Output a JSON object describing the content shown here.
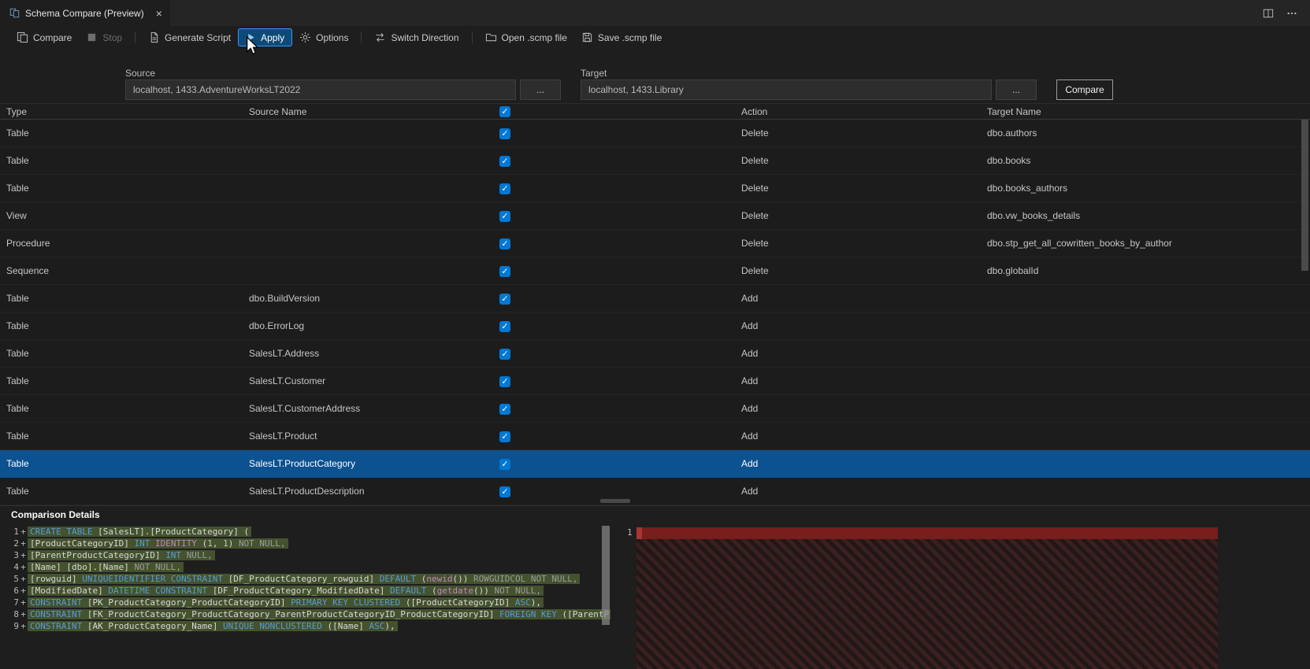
{
  "colors": {
    "accent_blue": "#3794ff",
    "checkbox_blue": "#0078d4",
    "selected_row_blue": "#0c5190",
    "diff_added_green_bg": "#44522e",
    "diff_removed_red": "#7a1d1d"
  },
  "tab": {
    "title": "Schema Compare (Preview)",
    "close_glyph": "×",
    "icon": "schema-compare-icon"
  },
  "window_actions": {
    "icons": [
      "split-editor-icon",
      "more-actions-icon"
    ]
  },
  "toolbar": {
    "items": [
      {
        "label": "Compare",
        "icon": "compare-icon"
      },
      {
        "label": "Stop",
        "icon": "stop-icon",
        "disabled": true
      },
      {
        "label": "Generate Script",
        "icon": "generate-script-icon"
      },
      {
        "label": "Apply",
        "icon": "play-icon",
        "active": true
      },
      {
        "label": "Options",
        "icon": "gear-icon"
      },
      {
        "label": "Switch Direction",
        "icon": "switch-direction-icon"
      },
      {
        "label": "Open .scmp file",
        "icon": "open-file-icon"
      },
      {
        "label": "Save .scmp file",
        "icon": "save-icon"
      }
    ]
  },
  "connections": {
    "source": {
      "label": "Source",
      "value": "localhost, 1433.AdventureWorksLT2022",
      "browse": "..."
    },
    "target": {
      "label": "Target",
      "value": "localhost, 1433.Library",
      "browse": "..."
    },
    "compare_button": "Compare"
  },
  "grid": {
    "check_glyph": "✓",
    "columns": {
      "type": "Type",
      "source": "Source Name",
      "action": "Action",
      "target": "Target Name"
    },
    "rows": [
      {
        "type": "Table",
        "source": "",
        "checked": true,
        "action": "Delete",
        "target": "dbo.authors",
        "selected": false
      },
      {
        "type": "Table",
        "source": "",
        "checked": true,
        "action": "Delete",
        "target": "dbo.books",
        "selected": false
      },
      {
        "type": "Table",
        "source": "",
        "checked": true,
        "action": "Delete",
        "target": "dbo.books_authors",
        "selected": false
      },
      {
        "type": "View",
        "source": "",
        "checked": true,
        "action": "Delete",
        "target": "dbo.vw_books_details",
        "selected": false
      },
      {
        "type": "Procedure",
        "source": "",
        "checked": true,
        "action": "Delete",
        "target": "dbo.stp_get_all_cowritten_books_by_author",
        "selected": false
      },
      {
        "type": "Sequence",
        "source": "",
        "checked": true,
        "action": "Delete",
        "target": "dbo.globalId",
        "selected": false
      },
      {
        "type": "Table",
        "source": "dbo.BuildVersion",
        "checked": true,
        "action": "Add",
        "target": "",
        "selected": false
      },
      {
        "type": "Table",
        "source": "dbo.ErrorLog",
        "checked": true,
        "action": "Add",
        "target": "",
        "selected": false
      },
      {
        "type": "Table",
        "source": "SalesLT.Address",
        "checked": true,
        "action": "Add",
        "target": "",
        "selected": false
      },
      {
        "type": "Table",
        "source": "SalesLT.Customer",
        "checked": true,
        "action": "Add",
        "target": "",
        "selected": false
      },
      {
        "type": "Table",
        "source": "SalesLT.CustomerAddress",
        "checked": true,
        "action": "Add",
        "target": "",
        "selected": false
      },
      {
        "type": "Table",
        "source": "SalesLT.Product",
        "checked": true,
        "action": "Add",
        "target": "",
        "selected": false
      },
      {
        "type": "Table",
        "source": "SalesLT.ProductCategory",
        "checked": true,
        "action": "Add",
        "target": "",
        "selected": true
      },
      {
        "type": "Table",
        "source": "SalesLT.ProductDescription",
        "checked": true,
        "action": "Add",
        "target": "",
        "selected": false
      }
    ]
  },
  "details": {
    "title": "Comparison Details",
    "left_editor": {
      "lines": [
        {
          "num": "1",
          "sign": "+",
          "tokens": [
            [
              "k",
              "CREATE TABLE "
            ],
            [
              "d",
              "[SalesLT].[ProductCategory] ("
            ]
          ]
        },
        {
          "num": "2",
          "sign": "+",
          "tokens": [
            [
              "d",
              "[ProductCategoryID] "
            ],
            [
              "k",
              "INT "
            ],
            [
              "f",
              "IDENTITY "
            ],
            [
              "d",
              "("
            ],
            [
              "n",
              "1"
            ],
            [
              "d",
              ", "
            ],
            [
              "n",
              "1"
            ],
            [
              "d",
              ") "
            ],
            [
              "g",
              "NOT NULL,"
            ]
          ]
        },
        {
          "num": "3",
          "sign": "+",
          "tokens": [
            [
              "d",
              "[ParentProductCategoryID] "
            ],
            [
              "k",
              "INT "
            ],
            [
              "g",
              "NULL,"
            ]
          ]
        },
        {
          "num": "4",
          "sign": "+",
          "tokens": [
            [
              "d",
              "[Name] [dbo].[Name] "
            ],
            [
              "g",
              "NOT NULL,"
            ]
          ]
        },
        {
          "num": "5",
          "sign": "+",
          "tokens": [
            [
              "d",
              "[rowguid] "
            ],
            [
              "k",
              "UNIQUEIDENTIFIER "
            ],
            [
              "k",
              "CONSTRAINT "
            ],
            [
              "d",
              "[DF_ProductCategory_rowguid] "
            ],
            [
              "k",
              "DEFAULT "
            ],
            [
              "d",
              "("
            ],
            [
              "f",
              "newid"
            ],
            [
              "d",
              "()) "
            ],
            [
              "g",
              "ROWGUIDCOL NOT NULL,"
            ]
          ]
        },
        {
          "num": "6",
          "sign": "+",
          "tokens": [
            [
              "d",
              "[ModifiedDate] "
            ],
            [
              "k",
              "DATETIME "
            ],
            [
              "k",
              "CONSTRAINT "
            ],
            [
              "d",
              "[DF_ProductCategory_ModifiedDate] "
            ],
            [
              "k",
              "DEFAULT "
            ],
            [
              "d",
              "("
            ],
            [
              "f",
              "getdate"
            ],
            [
              "d",
              "()) "
            ],
            [
              "g",
              "NOT NULL,"
            ]
          ]
        },
        {
          "num": "7",
          "sign": "+",
          "tokens": [
            [
              "k",
              "CONSTRAINT "
            ],
            [
              "d",
              "[PK_ProductCategory_ProductCategoryID] "
            ],
            [
              "k",
              "PRIMARY KEY CLUSTERED "
            ],
            [
              "d",
              "([ProductCategoryID] "
            ],
            [
              "k",
              "ASC"
            ],
            [
              "d",
              "),"
            ]
          ]
        },
        {
          "num": "8",
          "sign": "+",
          "tokens": [
            [
              "k",
              "CONSTRAINT "
            ],
            [
              "d",
              "[FK_ProductCategory_ProductCategory_ParentProductCategoryID_ProductCategoryID] "
            ],
            [
              "k",
              "FOREIGN KEY "
            ],
            [
              "d",
              "([ParentProductCatego"
            ]
          ]
        },
        {
          "num": "9",
          "sign": "+",
          "tokens": [
            [
              "k",
              "CONSTRAINT "
            ],
            [
              "d",
              "[AK_ProductCategory_Name] "
            ],
            [
              "k",
              "UNIQUE NONCLUSTERED "
            ],
            [
              "d",
              "([Name] "
            ],
            [
              "k",
              "ASC"
            ],
            [
              "d",
              "),"
            ]
          ]
        }
      ]
    },
    "right_editor": {
      "first_line_number": "1"
    }
  }
}
